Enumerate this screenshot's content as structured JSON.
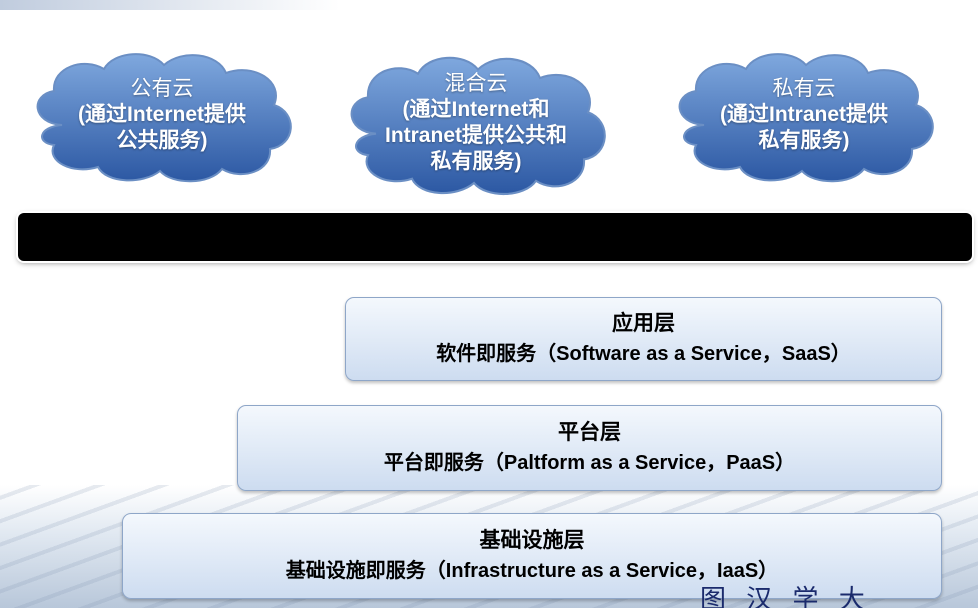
{
  "clouds": [
    {
      "title": "公有云",
      "subtitle": "(通过Internet提供公共服务)"
    },
    {
      "title": "混合云",
      "subtitle": "(通过Internet和Intranet提供公共和私有服务)"
    },
    {
      "title": "私有云",
      "subtitle": "(通过Intranet提供私有服务)"
    }
  ],
  "layers": [
    {
      "name": "应用层",
      "desc": "软件即服务（Software as a Service，SaaS）"
    },
    {
      "name": "平台层",
      "desc": "平台即服务（Paltform as a Service，PaaS）"
    },
    {
      "name": "基础设施层",
      "desc": "基础设施即服务（Infrastructure as a Service，IaaS）"
    }
  ],
  "colors": {
    "cloud_fill_top": "#6f9bd6",
    "cloud_fill_bottom": "#2f5da8",
    "bar": "#000000",
    "layer_border": "#8ea6c8"
  },
  "logo_text": "图 汉 学 大"
}
